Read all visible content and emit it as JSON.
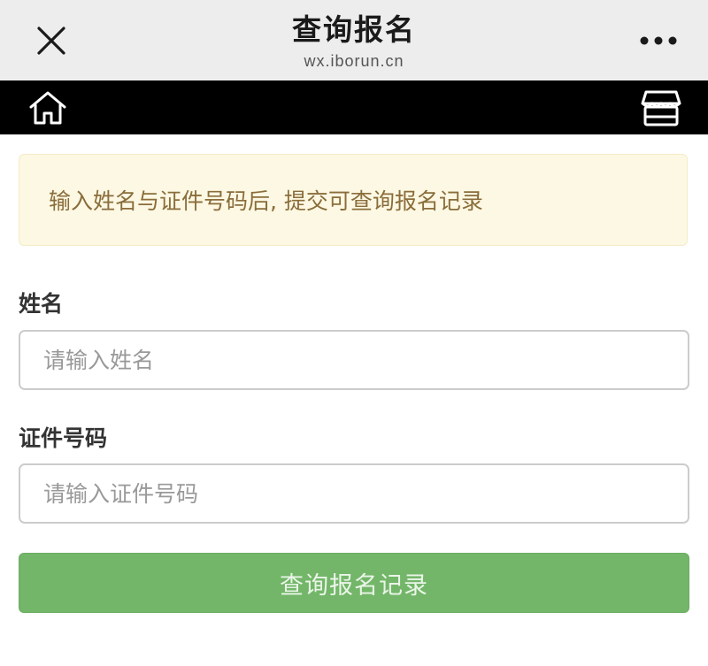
{
  "window": {
    "title": "查询报名",
    "domain": "wx.iborun.cn",
    "close_icon": "close-icon",
    "more_icon": "more-icon"
  },
  "navbar": {
    "home_icon": "home-icon",
    "shop_icon": "shop-icon"
  },
  "notice": {
    "text": "输入姓名与证件号码后, 提交可查询报名记录"
  },
  "form": {
    "name_label": "姓名",
    "name_placeholder": "请输入姓名",
    "id_label": "证件号码",
    "id_placeholder": "请输入证件号码",
    "submit_label": "查询报名记录"
  },
  "colors": {
    "titlebar_bg": "#ededed",
    "navbar_bg": "#000000",
    "notice_bg": "#fcf8e3",
    "notice_text": "#8a6d3b",
    "button_bg": "#73b669"
  }
}
